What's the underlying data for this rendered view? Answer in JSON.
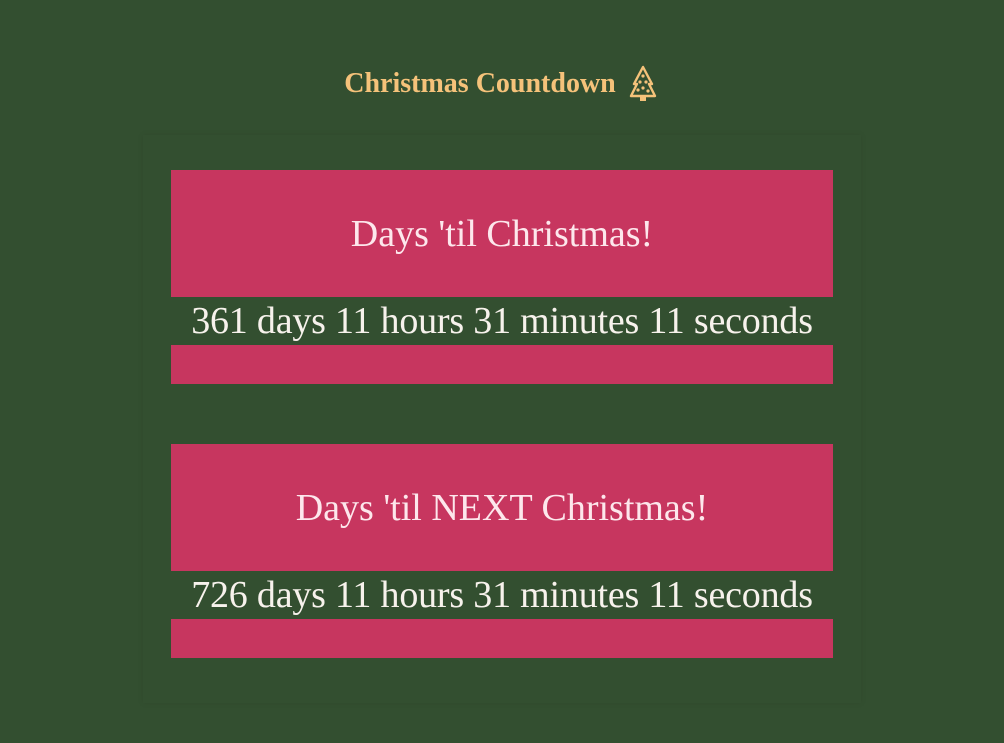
{
  "header": {
    "title": "Christmas Countdown",
    "icon": "christmas-tree-icon"
  },
  "colors": {
    "background": "#334f30",
    "title": "#f5c27a",
    "card": "#c7365f",
    "text": "#f7f2ec"
  },
  "countdowns": [
    {
      "label": "Days 'til Christmas!",
      "time": "361 days 11 hours 31 minutes 11 seconds"
    },
    {
      "label": "Days 'til NEXT Christmas!",
      "time": "726 days 11 hours 31 minutes 11 seconds"
    }
  ]
}
